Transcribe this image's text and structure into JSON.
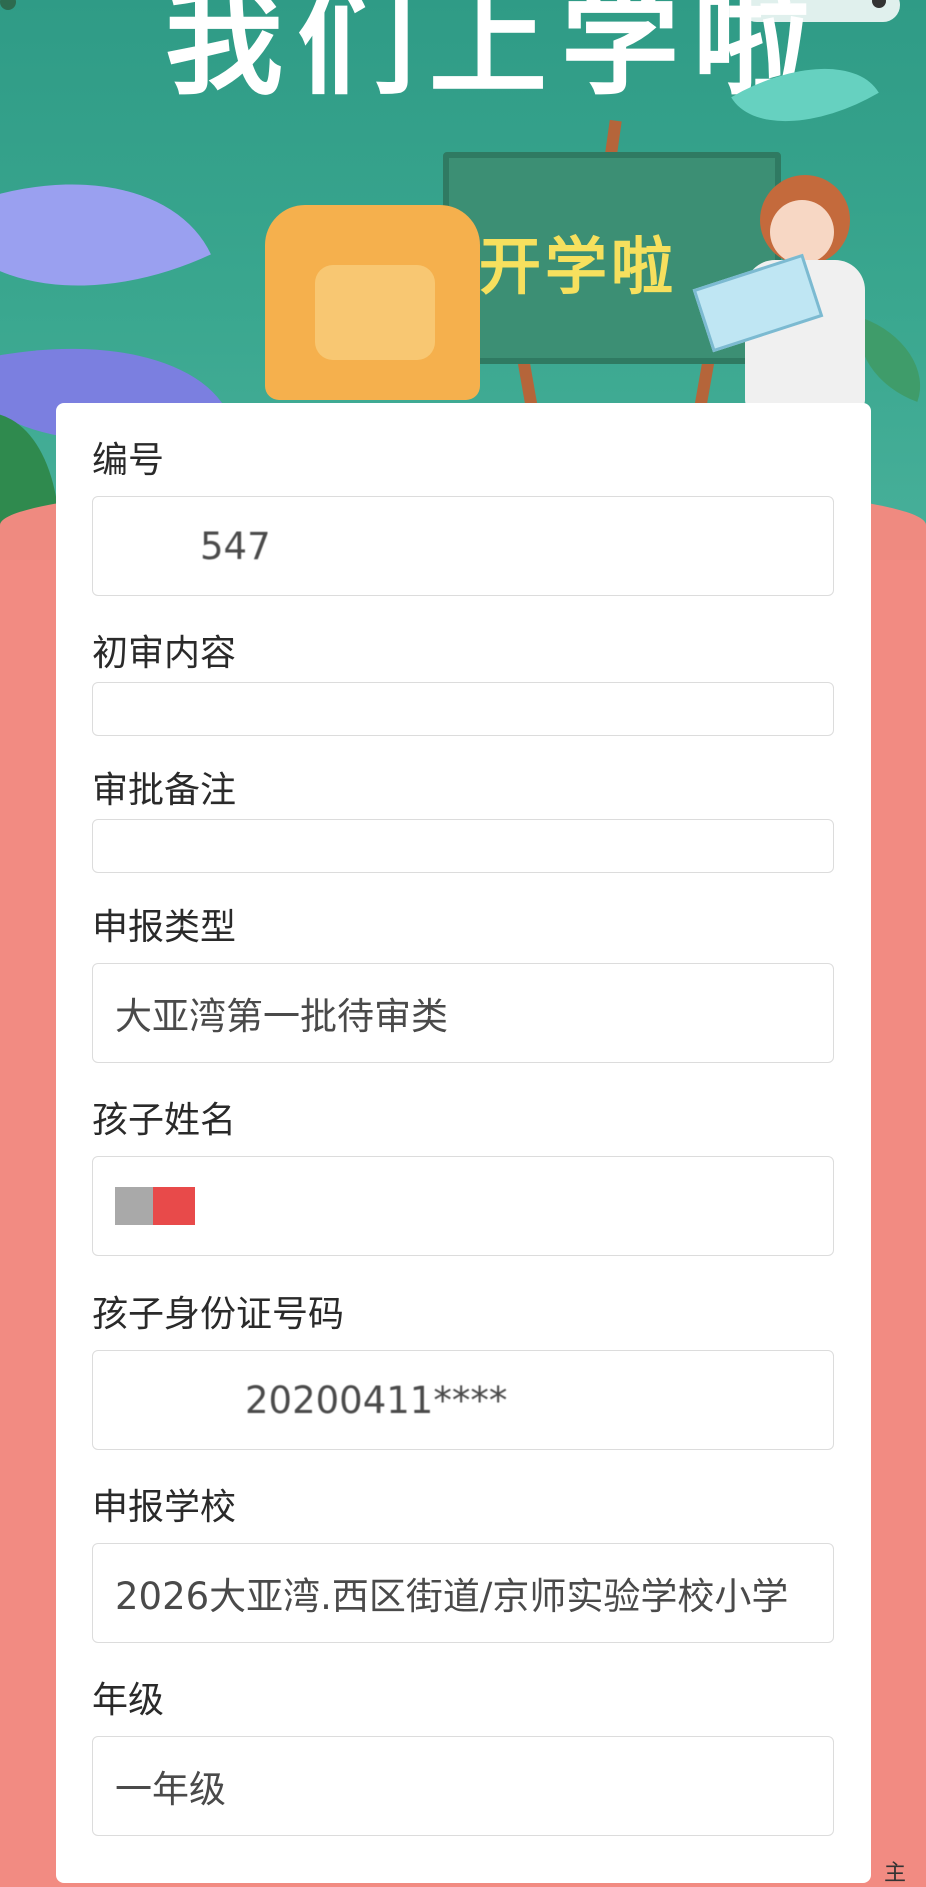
{
  "banner": {
    "title": "我们上学啦",
    "blackboard_text": "开学啦"
  },
  "form": {
    "fields": [
      {
        "label": "编号",
        "value": "547"
      },
      {
        "label": "初审内容",
        "value": ""
      },
      {
        "label": "审批备注",
        "value": ""
      },
      {
        "label": "申报类型",
        "value": "大亚湾第一批待审类"
      },
      {
        "label": "孩子姓名",
        "value": ""
      },
      {
        "label": "孩子身份证号码",
        "value": "20200411****"
      },
      {
        "label": "申报学校",
        "value": "2026大亚湾.西区街道/京师实验学校小学"
      },
      {
        "label": "年级",
        "value": "一年级"
      }
    ]
  },
  "footer": {
    "corner_text": "主"
  },
  "colors": {
    "banner_green": "#3aa78f",
    "page_pink": "#f28b82",
    "chalk_yellow": "#f6e05e",
    "mask_red": "#e84a4a",
    "mask_gray": "#a9a9a9"
  }
}
